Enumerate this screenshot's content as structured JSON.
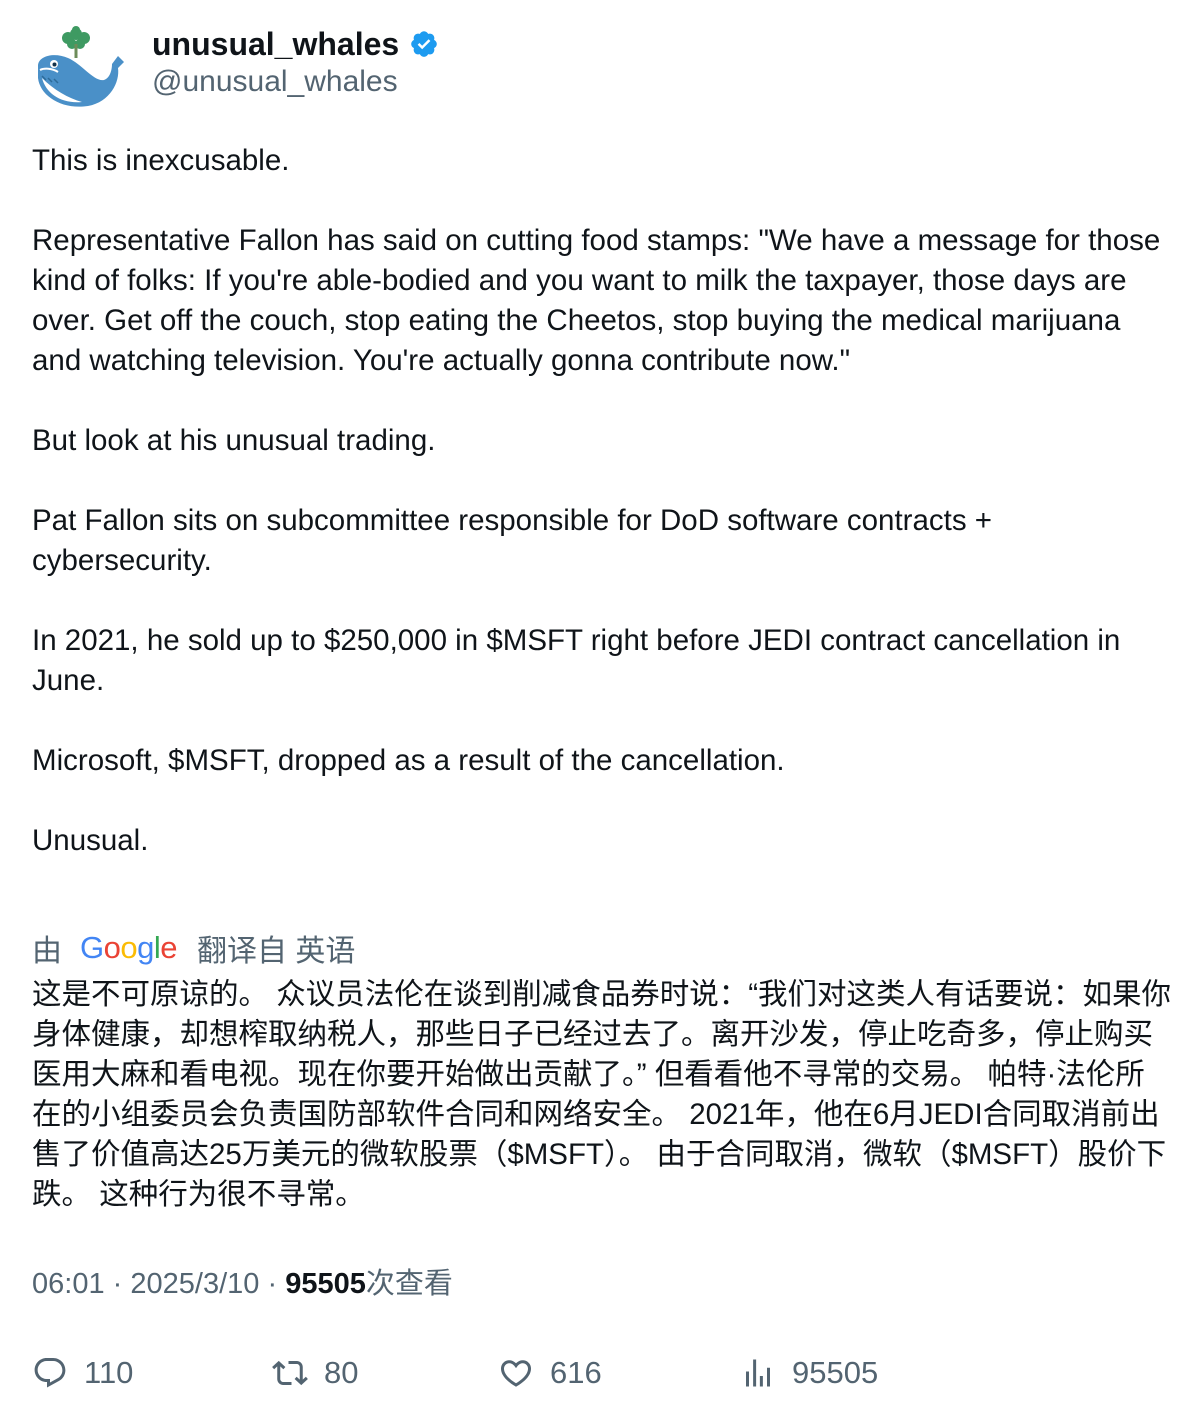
{
  "author": {
    "name": "unusual_whales",
    "handle": "@unusual_whales",
    "verified": true,
    "avatar_icon": "whale-logo"
  },
  "tweet": {
    "paragraphs": [
      "This is inexcusable.",
      "Representative Fallon has said on cutting food stamps: \"We have a message for those kind of folks: If you're able-bodied and you want to milk the taxpayer, those days are over. Get off the couch, stop eating the Cheetos, stop buying the medical marijuana and watching television. You're actually gonna contribute now.\"",
      "But look at his unusual trading.",
      "Pat Fallon sits on subcommittee responsible for DoD software contracts + cybersecurity.",
      "In 2021, he sold up to $250,000 in $MSFT right before JEDI contract cancellation in June.",
      "Microsoft, $MSFT, dropped as a result of the cancellation.",
      "Unusual."
    ]
  },
  "translation": {
    "by_label": "由",
    "provider": "Google",
    "from_label": "翻译自 英语",
    "text": "这是不可原谅的。 众议员法伦在谈到削减食品券时说：“我们对这类人有话要说：如果你身体健康，却想榨取纳税人，那些日子已经过去了。离开沙发，停止吃奇多，停止购买医用大麻和看电视。现在你要开始做出贡献了。” 但看看他不寻常的交易。 帕特·法伦所在的小组委员会负责国防部软件合同和网络安全。 2021年，他在6月JEDI合同取消前出售了价值高达25万美元的微软股票（$MSFT）。 由于合同取消，微软（$MSFT）股价下跌。 这种行为很不寻常。"
  },
  "meta": {
    "time": "06:01",
    "separator": "·",
    "date": "2025/3/10",
    "views_count": "95505",
    "views_label": "次查看"
  },
  "actions": {
    "replies": "110",
    "retweets": "80",
    "likes": "616",
    "views": "95505"
  },
  "colors": {
    "text": "#0f1419",
    "secondary": "#536471",
    "verified": "#1d9bf0",
    "whale": "#4a90c8"
  }
}
